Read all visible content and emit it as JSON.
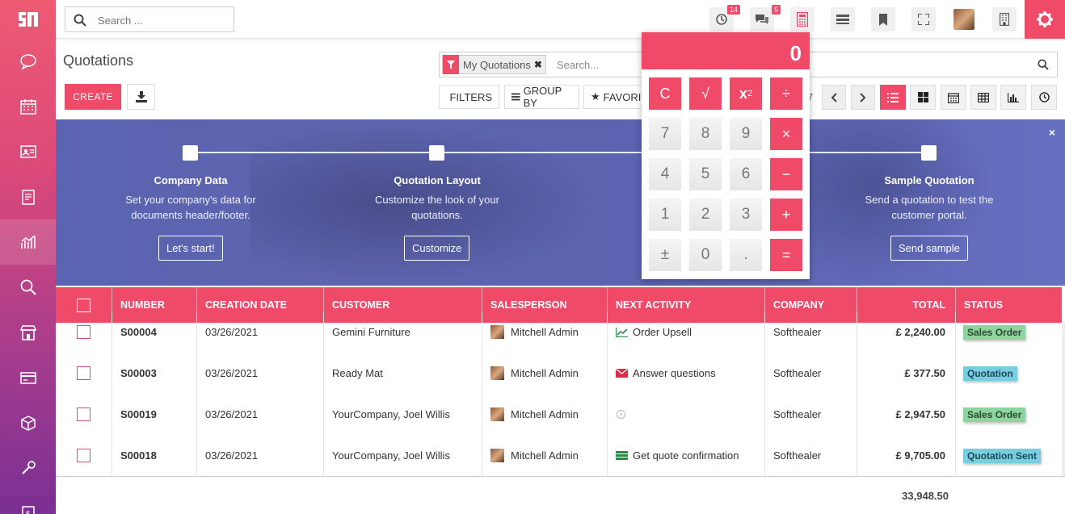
{
  "colors": {
    "accent": "#ef4a68",
    "sales_order": "#8fd49e",
    "quotation": "#79cde0"
  },
  "topbar": {
    "search_placeholder": "Search ...",
    "activity_badge": "14",
    "messages_badge": "5",
    "icons": [
      "activity-clock-icon",
      "messages-icon",
      "calculator-icon",
      "menu-lines-icon",
      "bookmark-icon",
      "fullscreen-icon",
      "user-avatar",
      "building-icon",
      "gear-icon"
    ]
  },
  "sidebar": {
    "icons": [
      "discuss-icon",
      "calendar-icon",
      "contacts-icon",
      "crm-icon",
      "sales-chart-icon",
      "search-icon",
      "store-icon",
      "invoice-icon",
      "inventory-box-icon",
      "tools-icon",
      "payroll-icon"
    ]
  },
  "page": {
    "title": "Quotations",
    "create_label": "CREATE",
    "search": {
      "facet_label": "My Quotations",
      "placeholder": "Search..."
    },
    "filters_label": "FILTERS",
    "groupby_label": "GROUP BY",
    "favorites_label": "FAVORIT",
    "pager_tail": "7"
  },
  "banner": {
    "steps": [
      {
        "title": "Company Data",
        "desc": "Set your company's data for documents header/footer.",
        "button": "Let's start!"
      },
      {
        "title": "Quotation Layout",
        "desc": "Customize the look of your quotations.",
        "button": "Customize"
      },
      {
        "title": "Sample Quotation",
        "desc": "Send a quotation to test the customer portal.",
        "button": "Send sample"
      }
    ],
    "close": "×"
  },
  "table": {
    "columns": [
      "NUMBER",
      "CREATION DATE",
      "CUSTOMER",
      "SALESPERSON",
      "NEXT ACTIVITY",
      "COMPANY",
      "TOTAL",
      "STATUS"
    ],
    "rows": [
      {
        "number": "S00004",
        "date": "03/26/2021",
        "customer": "Gemini Furniture",
        "salesperson": "Mitchell Admin",
        "activity": "Order Upsell",
        "activity_icon": "chart-up-icon",
        "company": "Softhealer",
        "total": "£ 2,240.00",
        "status": "Sales Order"
      },
      {
        "number": "S00003",
        "date": "03/26/2021",
        "customer": "Ready Mat",
        "salesperson": "Mitchell Admin",
        "activity": "Answer questions",
        "activity_icon": "envelope-icon",
        "company": "Softhealer",
        "total": "£ 377.50",
        "status": "Quotation"
      },
      {
        "number": "S00019",
        "date": "03/26/2021",
        "customer": "YourCompany, Joel Willis",
        "salesperson": "Mitchell Admin",
        "activity": "",
        "activity_icon": "clock-icon",
        "company": "Softhealer",
        "total": "£ 2,947.50",
        "status": "Sales Order"
      },
      {
        "number": "S00018",
        "date": "03/26/2021",
        "customer": "YourCompany, Joel Willis",
        "salesperson": "Mitchell Admin",
        "activity": "Get quote confirmation",
        "activity_icon": "list-icon",
        "company": "Softhealer",
        "total": "£ 9,705.00",
        "status": "Quotation Sent"
      }
    ],
    "grand_total": "33,948.50"
  },
  "calculator": {
    "display": "0",
    "keys": [
      [
        "C",
        "√",
        "x2",
        "÷"
      ],
      [
        "7",
        "8",
        "9",
        "×"
      ],
      [
        "4",
        "5",
        "6",
        "−"
      ],
      [
        "1",
        "2",
        "3",
        "+"
      ],
      [
        "±",
        "0",
        ".",
        "="
      ]
    ]
  }
}
